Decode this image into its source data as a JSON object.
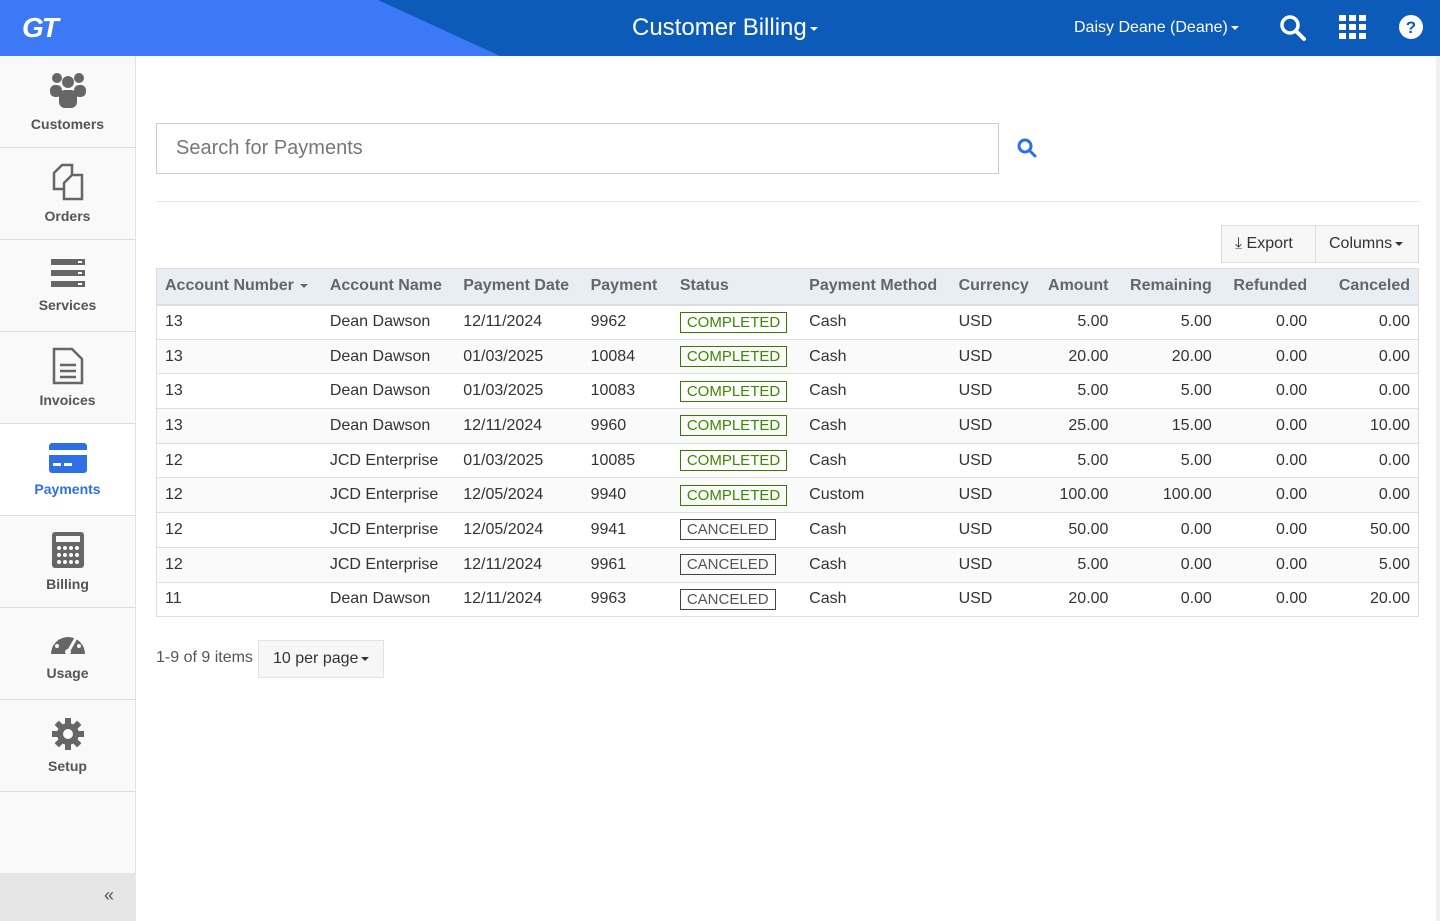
{
  "header": {
    "logo": "GT",
    "title": "Customer Billing",
    "user": "Daisy Deane (Deane)",
    "icons": [
      "search-icon",
      "apps-grid-icon",
      "help-icon"
    ],
    "colors": {
      "primary": "#0d5bb8",
      "accent": "#3b79f6"
    }
  },
  "sidebar": {
    "items": [
      {
        "label": "Customers",
        "icon": "users-icon"
      },
      {
        "label": "Orders",
        "icon": "orders-icon"
      },
      {
        "label": "Services",
        "icon": "services-icon"
      },
      {
        "label": "Invoices",
        "icon": "invoice-icon"
      },
      {
        "label": "Payments",
        "icon": "credit-card-icon",
        "active": true
      },
      {
        "label": "Billing",
        "icon": "calculator-icon"
      },
      {
        "label": "Usage",
        "icon": "gauge-icon"
      },
      {
        "label": "Setup",
        "icon": "gear-icon"
      }
    ],
    "collapse": "«"
  },
  "search": {
    "placeholder": "Search for Payments",
    "value": ""
  },
  "toolbar": {
    "export": "Export",
    "columns": "Columns"
  },
  "table": {
    "columns": [
      "Account Number",
      "Account Name",
      "Payment Date",
      "Payment",
      "Status",
      "Payment Method",
      "Currency",
      "Amount",
      "Remaining",
      "Refunded",
      "Canceled"
    ],
    "rows": [
      [
        "13",
        "Dean Dawson",
        "12/11/2024",
        "9962",
        "COMPLETED",
        "Cash",
        "USD",
        "5.00",
        "5.00",
        "0.00",
        "0.00"
      ],
      [
        "13",
        "Dean Dawson",
        "01/03/2025",
        "10084",
        "COMPLETED",
        "Cash",
        "USD",
        "20.00",
        "20.00",
        "0.00",
        "0.00"
      ],
      [
        "13",
        "Dean Dawson",
        "01/03/2025",
        "10083",
        "COMPLETED",
        "Cash",
        "USD",
        "5.00",
        "5.00",
        "0.00",
        "0.00"
      ],
      [
        "13",
        "Dean Dawson",
        "12/11/2024",
        "9960",
        "COMPLETED",
        "Cash",
        "USD",
        "25.00",
        "15.00",
        "0.00",
        "10.00"
      ],
      [
        "12",
        "JCD Enterprise",
        "01/03/2025",
        "10085",
        "COMPLETED",
        "Cash",
        "USD",
        "5.00",
        "5.00",
        "0.00",
        "0.00"
      ],
      [
        "12",
        "JCD Enterprise",
        "12/05/2024",
        "9940",
        "COMPLETED",
        "Custom",
        "USD",
        "100.00",
        "100.00",
        "0.00",
        "0.00"
      ],
      [
        "12",
        "JCD Enterprise",
        "12/05/2024",
        "9941",
        "CANCELED",
        "Cash",
        "USD",
        "50.00",
        "0.00",
        "0.00",
        "50.00"
      ],
      [
        "12",
        "JCD Enterprise",
        "12/11/2024",
        "9961",
        "CANCELED",
        "Cash",
        "USD",
        "5.00",
        "0.00",
        "0.00",
        "5.00"
      ],
      [
        "11",
        "Dean Dawson",
        "12/11/2024",
        "9963",
        "CANCELED",
        "Cash",
        "USD",
        "20.00",
        "0.00",
        "0.00",
        "20.00"
      ]
    ]
  },
  "pager": {
    "summary": "1-9 of 9 items",
    "per_page": "10 per page"
  }
}
